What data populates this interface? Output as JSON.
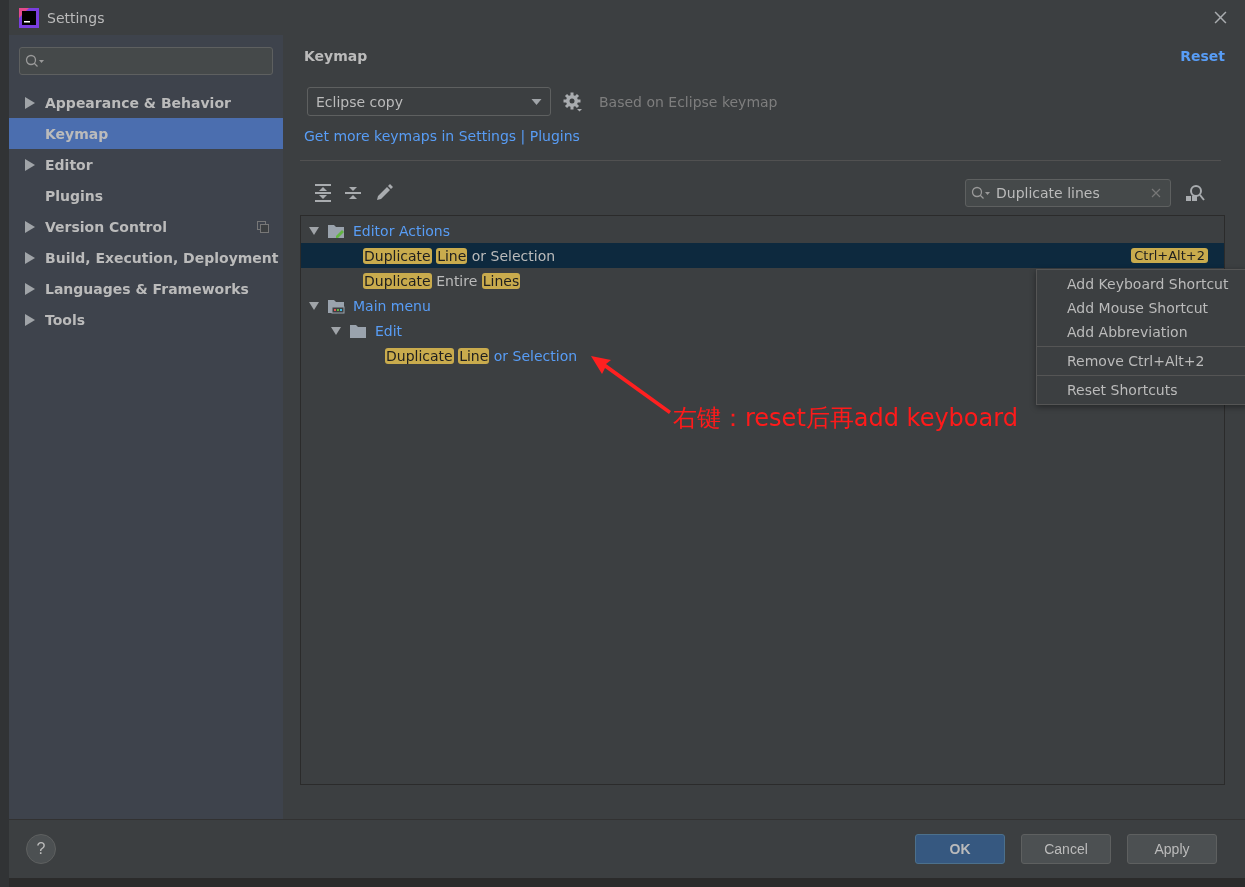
{
  "window": {
    "title": "Settings"
  },
  "sidebar": {
    "items": [
      {
        "label": "Appearance & Behavior",
        "expandable": true,
        "selected": false,
        "badge": false
      },
      {
        "label": "Keymap",
        "expandable": false,
        "selected": true,
        "badge": false
      },
      {
        "label": "Editor",
        "expandable": true,
        "selected": false,
        "badge": false
      },
      {
        "label": "Plugins",
        "expandable": false,
        "selected": false,
        "badge": false
      },
      {
        "label": "Version Control",
        "expandable": true,
        "selected": false,
        "badge": true
      },
      {
        "label": "Build, Execution, Deployment",
        "expandable": true,
        "selected": false,
        "badge": false
      },
      {
        "label": "Languages & Frameworks",
        "expandable": true,
        "selected": false,
        "badge": false
      },
      {
        "label": "Tools",
        "expandable": true,
        "selected": false,
        "badge": false
      }
    ]
  },
  "page": {
    "title": "Keymap",
    "reset": "Reset",
    "keymap_select": "Eclipse copy",
    "based_on": "Based on Eclipse keymap",
    "plugins_link": "Get more keymaps in Settings | Plugins",
    "search": {
      "value": "Duplicate lines"
    },
    "tree": [
      {
        "kind": "actions",
        "color": "#589df6",
        "expanded": true,
        "selected": false,
        "parts": [
          {
            "text": "Editor Actions",
            "match": false
          }
        ],
        "children": [
          {
            "kind": "action",
            "color": "#bbbbbb",
            "selected": true,
            "shortcut": "Ctrl+Alt+2",
            "parts": [
              {
                "text": "Duplicate",
                "match": true
              },
              {
                "text": "Line",
                "match": true
              },
              {
                "text": "or Selection",
                "match": false
              }
            ]
          },
          {
            "kind": "action",
            "color": "#bbbbbb",
            "selected": false,
            "parts": [
              {
                "text": "Duplicate",
                "match": true
              },
              {
                "text": "Entire",
                "match": false
              },
              {
                "text": "Lines",
                "match": true
              }
            ]
          }
        ]
      },
      {
        "kind": "menu",
        "color": "#589df6",
        "expanded": true,
        "selected": false,
        "parts": [
          {
            "text": "Main menu",
            "match": false
          }
        ],
        "children": [
          {
            "kind": "folder",
            "color": "#589df6",
            "expanded": true,
            "selected": false,
            "parts": [
              {
                "text": "Edit",
                "match": false
              }
            ],
            "children": [
              {
                "kind": "action",
                "color": "#589df6",
                "selected": false,
                "parts": [
                  {
                    "text": "Duplicate",
                    "match": true
                  },
                  {
                    "text": "Line",
                    "match": true
                  },
                  {
                    "text": "or Selection",
                    "match": false
                  }
                ]
              }
            ]
          }
        ]
      }
    ]
  },
  "context_menu": [
    {
      "label": "Add Keyboard Shortcut",
      "separator_before": false
    },
    {
      "label": "Add Mouse Shortcut",
      "separator_before": false
    },
    {
      "label": "Add Abbreviation",
      "separator_before": false
    },
    {
      "label": "Remove Ctrl+Alt+2",
      "separator_before": true
    },
    {
      "label": "Reset Shortcuts",
      "separator_before": true
    }
  ],
  "annotation": {
    "text": "右键：reset后再add keyboard"
  },
  "footer": {
    "help": "?"
  },
  "buttons": [
    {
      "label": "OK",
      "default": true
    },
    {
      "label": "Cancel",
      "default": false
    },
    {
      "label": "Apply",
      "default": false
    }
  ]
}
